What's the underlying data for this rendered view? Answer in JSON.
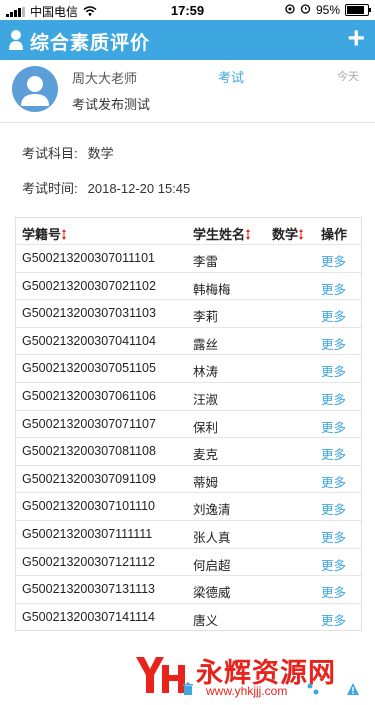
{
  "status_bar": {
    "carrier": "中国电信",
    "time": "17:59",
    "battery": "95%"
  },
  "nav": {
    "title": "综合素质评价",
    "add_label": "+"
  },
  "message": {
    "teacher": "周大大老师",
    "category": "考试",
    "time": "今天",
    "subject": "考试发布测试"
  },
  "exam_info": {
    "subject_label": "考试科目:",
    "subject_value": "数学",
    "time_label": "考试时间:",
    "time_value": "2018-12-20 15:45"
  },
  "table": {
    "headers": [
      "学籍号",
      "学生姓名",
      "数学",
      "操作"
    ],
    "rows": [
      {
        "id": "G500213200307011101",
        "name": "李雷",
        "score": "",
        "action": "更多"
      },
      {
        "id": "G500213200307021102",
        "name": "韩梅梅",
        "score": "",
        "action": "更多"
      },
      {
        "id": "G500213200307031103",
        "name": "李莉",
        "score": "",
        "action": "更多"
      },
      {
        "id": "G500213200307041104",
        "name": "露丝",
        "score": "",
        "action": "更多"
      },
      {
        "id": "G500213200307051105",
        "name": "林涛",
        "score": "",
        "action": "更多"
      },
      {
        "id": "G500213200307061106",
        "name": "汪淑",
        "score": "",
        "action": "更多"
      },
      {
        "id": "G500213200307071107",
        "name": "保利",
        "score": "",
        "action": "更多"
      },
      {
        "id": "G500213200307081108",
        "name": "麦克",
        "score": "",
        "action": "更多"
      },
      {
        "id": "G500213200307091109",
        "name": "蒂姆",
        "score": "",
        "action": "更多"
      },
      {
        "id": "G500213200307101110",
        "name": "刘逸清",
        "score": "",
        "action": "更多"
      },
      {
        "id": "G500213200307111111",
        "name": "张人真",
        "score": "",
        "action": "更多"
      },
      {
        "id": "G500213200307121112",
        "name": "何启超",
        "score": "",
        "action": "更多"
      },
      {
        "id": "G500213200307131113",
        "name": "梁德威",
        "score": "",
        "action": "更多"
      },
      {
        "id": "G500213200307141114",
        "name": "唐义",
        "score": "",
        "action": "更多"
      }
    ]
  },
  "watermark": {
    "text": "永辉资源网",
    "url": "www.yhkjjj.com"
  },
  "colors": {
    "accent": "#3ea7e1",
    "watermark": "#e8231b"
  },
  "icons": [
    "wifi-icon",
    "alarm-icon",
    "user-icon",
    "plus-icon",
    "sort-icon",
    "trash-icon",
    "edit-icon",
    "warning-icon"
  ]
}
